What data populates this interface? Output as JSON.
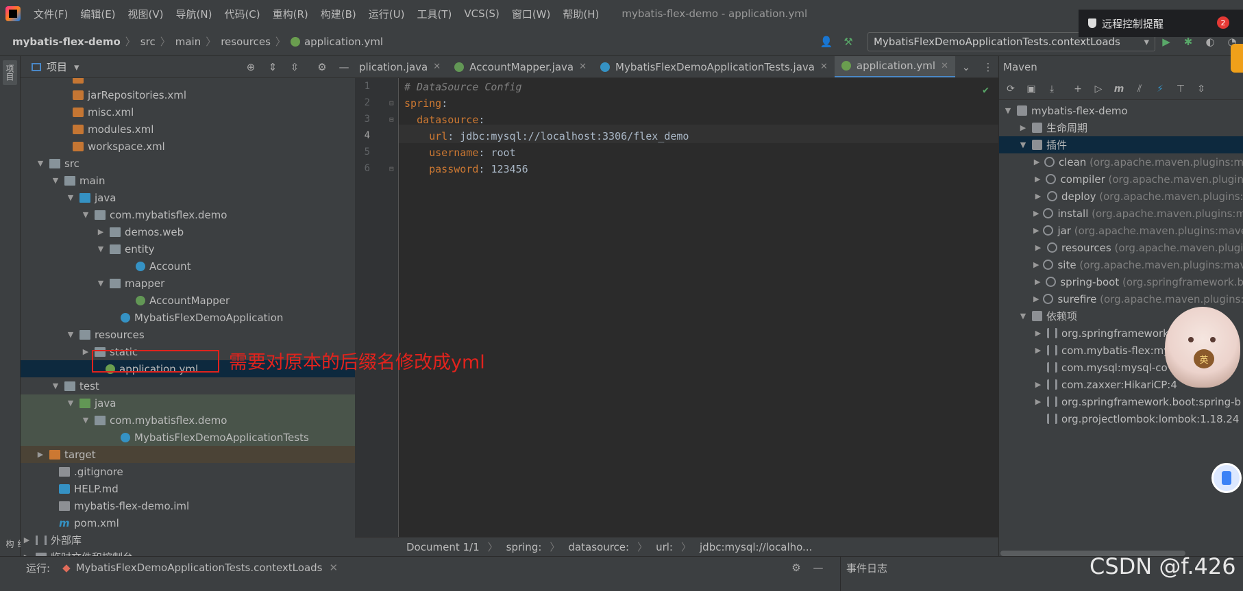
{
  "menu": {
    "items": [
      "文件(F)",
      "编辑(E)",
      "视图(V)",
      "导航(N)",
      "代码(C)",
      "重构(R)",
      "构建(B)",
      "运行(U)",
      "工具(T)",
      "VCS(S)",
      "窗口(W)",
      "帮助(H)"
    ],
    "window_title": "mybatis-flex-demo - application.yml"
  },
  "notification": {
    "text": "远程控制提醒",
    "count": "2"
  },
  "breadcrumb": {
    "project": "mybatis-flex-demo",
    "parts": [
      "src",
      "main",
      "resources",
      "application.yml"
    ]
  },
  "run_config": {
    "label": "MybatisFlexDemoApplicationTests.contextLoads"
  },
  "project_panel": {
    "title": "项目",
    "tree": [
      {
        "label": "jarRepositories.xml",
        "icon": "xml"
      },
      {
        "label": "misc.xml",
        "icon": "xml"
      },
      {
        "label": "modules.xml",
        "icon": "xml"
      },
      {
        "label": "workspace.xml",
        "icon": "xml"
      },
      {
        "label": "src",
        "icon": "folder"
      },
      {
        "label": "main",
        "icon": "folder"
      },
      {
        "label": "java",
        "icon": "folder-blue"
      },
      {
        "label": "com.mybatisflex.demo",
        "icon": "package"
      },
      {
        "label": "demos.web",
        "icon": "package"
      },
      {
        "label": "entity",
        "icon": "package"
      },
      {
        "label": "Account",
        "icon": "class"
      },
      {
        "label": "mapper",
        "icon": "package"
      },
      {
        "label": "AccountMapper",
        "icon": "interface"
      },
      {
        "label": "MybatisFlexDemoApplication",
        "icon": "spring-class"
      },
      {
        "label": "resources",
        "icon": "folder"
      },
      {
        "label": "static",
        "icon": "folder"
      },
      {
        "label": "application.yml",
        "icon": "yaml"
      },
      {
        "label": "test",
        "icon": "folder"
      },
      {
        "label": "java",
        "icon": "folder-blue"
      },
      {
        "label": "com.mybatisflex.demo",
        "icon": "package"
      },
      {
        "label": "MybatisFlexDemoApplicationTests",
        "icon": "spring-class"
      },
      {
        "label": "target",
        "icon": "folder-orange"
      },
      {
        "label": ".gitignore",
        "icon": "text"
      },
      {
        "label": "HELP.md",
        "icon": "markdown"
      },
      {
        "label": "mybatis-flex-demo.iml",
        "icon": "text"
      },
      {
        "label": "pom.xml",
        "icon": "maven"
      },
      {
        "label": "外部库",
        "icon": "libraries"
      },
      {
        "label": "临时文件和控制台",
        "icon": "scratch"
      }
    ]
  },
  "annotation": {
    "text": "需要对原本的后缀名修改成yml"
  },
  "editor": {
    "tabs": [
      {
        "label": "plication.java",
        "icon": "class"
      },
      {
        "label": "AccountMapper.java",
        "icon": "interface"
      },
      {
        "label": "MybatisFlexDemoApplicationTests.java",
        "icon": "spring-class"
      },
      {
        "label": "application.yml",
        "icon": "yaml"
      }
    ],
    "line_numbers": [
      "1",
      "2",
      "3",
      "4",
      "5",
      "6"
    ],
    "lines": {
      "l1": "# DataSource Config",
      "l2_key": "spring",
      "l3_key": "datasource",
      "l4_key": "url",
      "l4_val": "jdbc:mysql://localhost:3306/flex_demo",
      "l5_key": "username",
      "l5_val": "root",
      "l6_key": "password",
      "l6_val": "123456"
    },
    "status": [
      "Document 1/1",
      "spring:",
      "datasource:",
      "url:",
      "jdbc:mysql://localho..."
    ]
  },
  "maven": {
    "title": "Maven",
    "tree": [
      {
        "label": "mybatis-flex-demo",
        "dim": ""
      },
      {
        "label": "生命周期",
        "dim": ""
      },
      {
        "label": "插件",
        "dim": ""
      },
      {
        "label": "clean",
        "dim": "(org.apache.maven.plugins:m"
      },
      {
        "label": "compiler",
        "dim": "(org.apache.maven.plugin"
      },
      {
        "label": "deploy",
        "dim": "(org.apache.maven.plugins:"
      },
      {
        "label": "install",
        "dim": "(org.apache.maven.plugins:m"
      },
      {
        "label": "jar",
        "dim": "(org.apache.maven.plugins:mave"
      },
      {
        "label": "resources",
        "dim": "(org.apache.maven.plugi"
      },
      {
        "label": "site",
        "dim": "(org.apache.maven.plugins:mav"
      },
      {
        "label": "spring-boot",
        "dim": "(org.springframework.b"
      },
      {
        "label": "surefire",
        "dim": "(org.apache.maven.plugins:"
      },
      {
        "label": "依赖项",
        "dim": ""
      },
      {
        "label": "org.springframework.b",
        "dim": ""
      },
      {
        "label": "com.mybatis-flex:my",
        "dim": ""
      },
      {
        "label": "com.mysql:mysql-co",
        "dim": ""
      },
      {
        "label": "com.zaxxer:HikariCP:4",
        "dim": ""
      },
      {
        "label": "org.springframework.boot:spring-b",
        "dim": ""
      },
      {
        "label": "org.projectlombok:lombok:1.18.24",
        "dim": ""
      }
    ]
  },
  "bottom": {
    "run_label": "运行:",
    "run_tab": "MybatisFlexDemoApplicationTests.contextLoads",
    "event_log": "事件日志"
  },
  "side_tabs": {
    "project": "项目",
    "structure": "结构"
  },
  "watermark": "CSDN @f.426"
}
